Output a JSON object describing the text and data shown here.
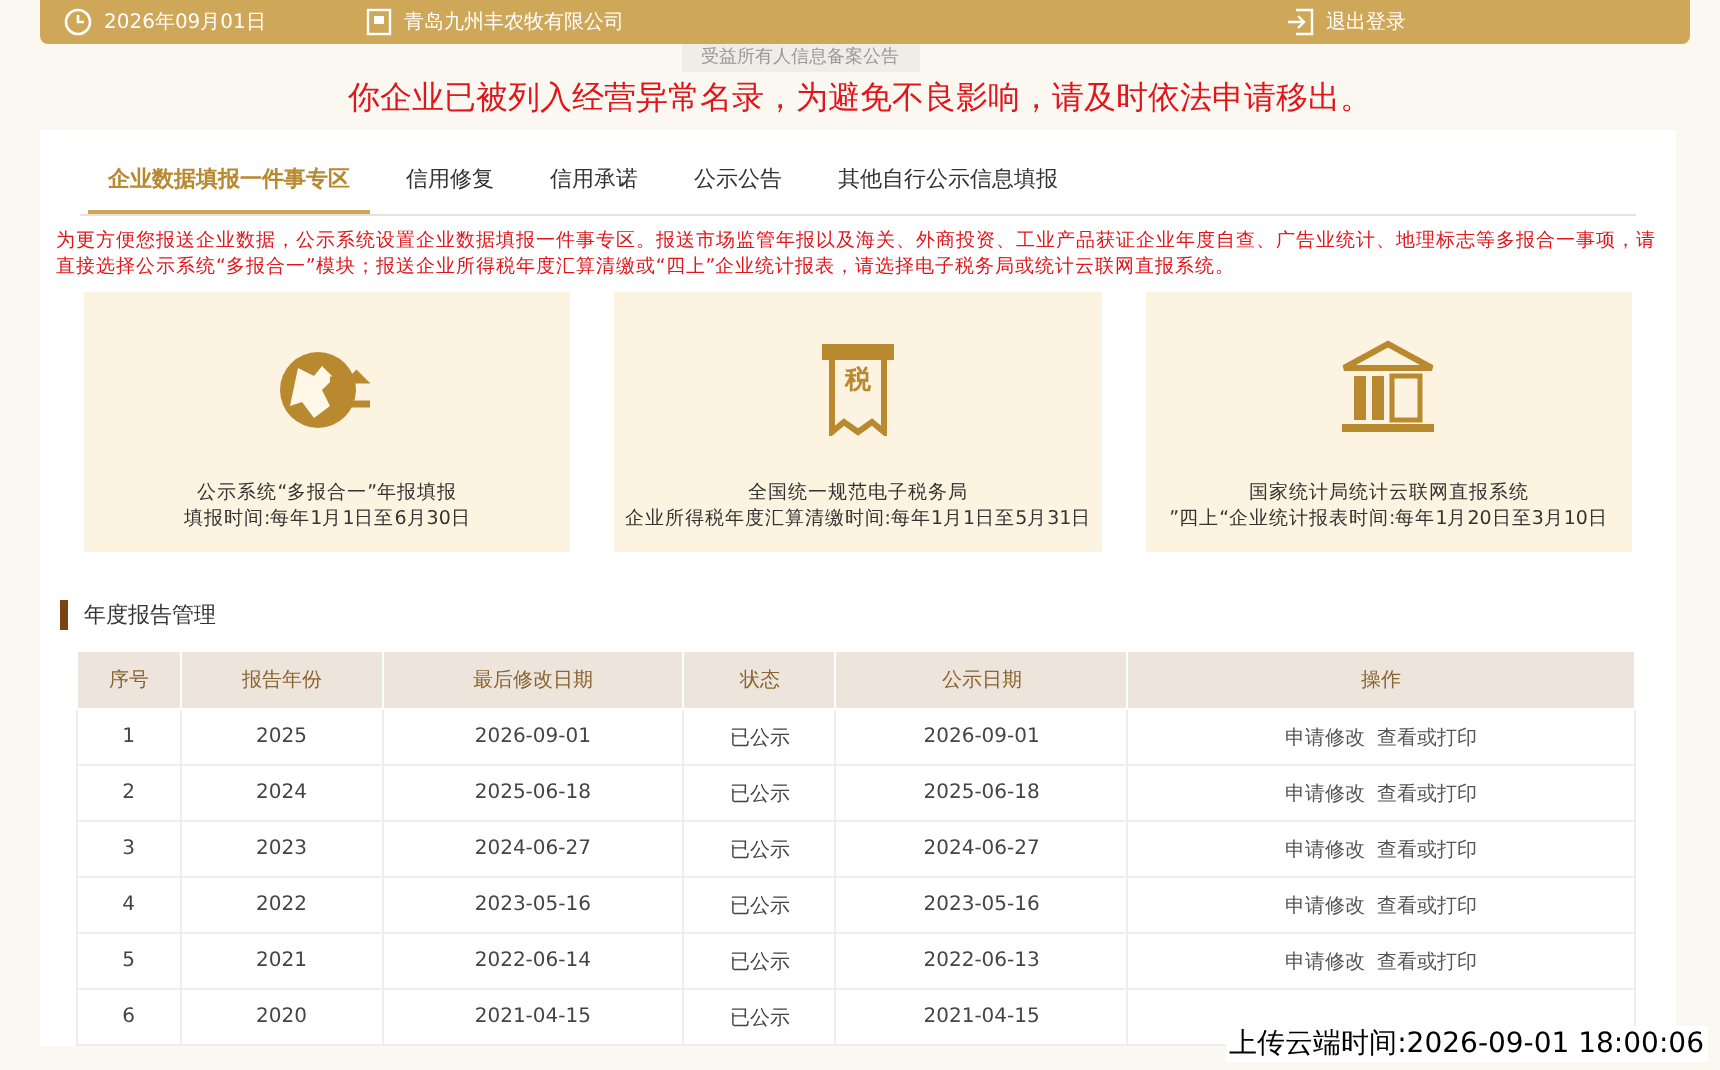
{
  "header": {
    "date": "2026年09月01日",
    "company": "青岛九州丰农牧有限公司",
    "logout": "退出登录"
  },
  "notice_tab": "受益所有人信息备案公告",
  "alert": "你企业已被列入经营异常名录，为避免不良影响，请及时依法申请移出。",
  "tabs": [
    {
      "label": "企业数据填报一件事专区",
      "selected": true
    },
    {
      "label": "信用修复",
      "selected": false
    },
    {
      "label": "信用承诺",
      "selected": false
    },
    {
      "label": "公示公告",
      "selected": false
    },
    {
      "label": "其他自行公示信息填报",
      "selected": false
    }
  ],
  "intro": "为更方便您报送企业数据，公示系统设置企业数据填报一件事专区。报送市场监管年报以及海关、外商投资、工业产品获证企业年度自查、广告业统计、地理标志等多报合一事项，请直接选择公示系统“多报合一”模块；报送企业所得税年度汇算清缴或“四上”企业统计报表，请选择电子税务局或统计云联网直报系统。",
  "cards": [
    {
      "kind": "globe",
      "line_1": "公示系统“多报合一”年报填报",
      "line_2": "填报时间:每年1月1日至6月30日"
    },
    {
      "kind": "tax",
      "tax_glyph": "税",
      "line_1": "全国统一规范电子税务局",
      "line_2": "企业所得税年度汇算清缴时间:每年1月1日至5月31日"
    },
    {
      "kind": "bank",
      "line_1": "国家统计局统计云联网直报系统",
      "line_2": "”四上“企业统计报表时间:每年1月20日至3月10日"
    }
  ],
  "section_title": "年度报告管理",
  "table": {
    "columns": [
      "序号",
      "报告年份",
      "最后修改日期",
      "状态",
      "公示日期",
      "操作"
    ],
    "rows": [
      {
        "no": "1",
        "year": "2025",
        "modified": "2026-09-01",
        "status": "已公示",
        "published": "2026-09-01",
        "actions": [
          "申请修改",
          "查看或打印"
        ]
      },
      {
        "no": "2",
        "year": "2024",
        "modified": "2025-06-18",
        "status": "已公示",
        "published": "2025-06-18",
        "actions": [
          "申请修改",
          "查看或打印"
        ]
      },
      {
        "no": "3",
        "year": "2023",
        "modified": "2024-06-27",
        "status": "已公示",
        "published": "2024-06-27",
        "actions": [
          "申请修改",
          "查看或打印"
        ]
      },
      {
        "no": "4",
        "year": "2022",
        "modified": "2023-05-16",
        "status": "已公示",
        "published": "2023-05-16",
        "actions": [
          "申请修改",
          "查看或打印"
        ]
      },
      {
        "no": "5",
        "year": "2021",
        "modified": "2022-06-14",
        "status": "已公示",
        "published": "2022-06-13",
        "actions": [
          "申请修改",
          "查看或打印"
        ]
      },
      {
        "no": "6",
        "year": "2020",
        "modified": "2021-04-15",
        "status": "已公示",
        "published": "2021-04-15"
      }
    ]
  },
  "upload_stamp": "上传云端时间:2026-09-01 18:00:06"
}
